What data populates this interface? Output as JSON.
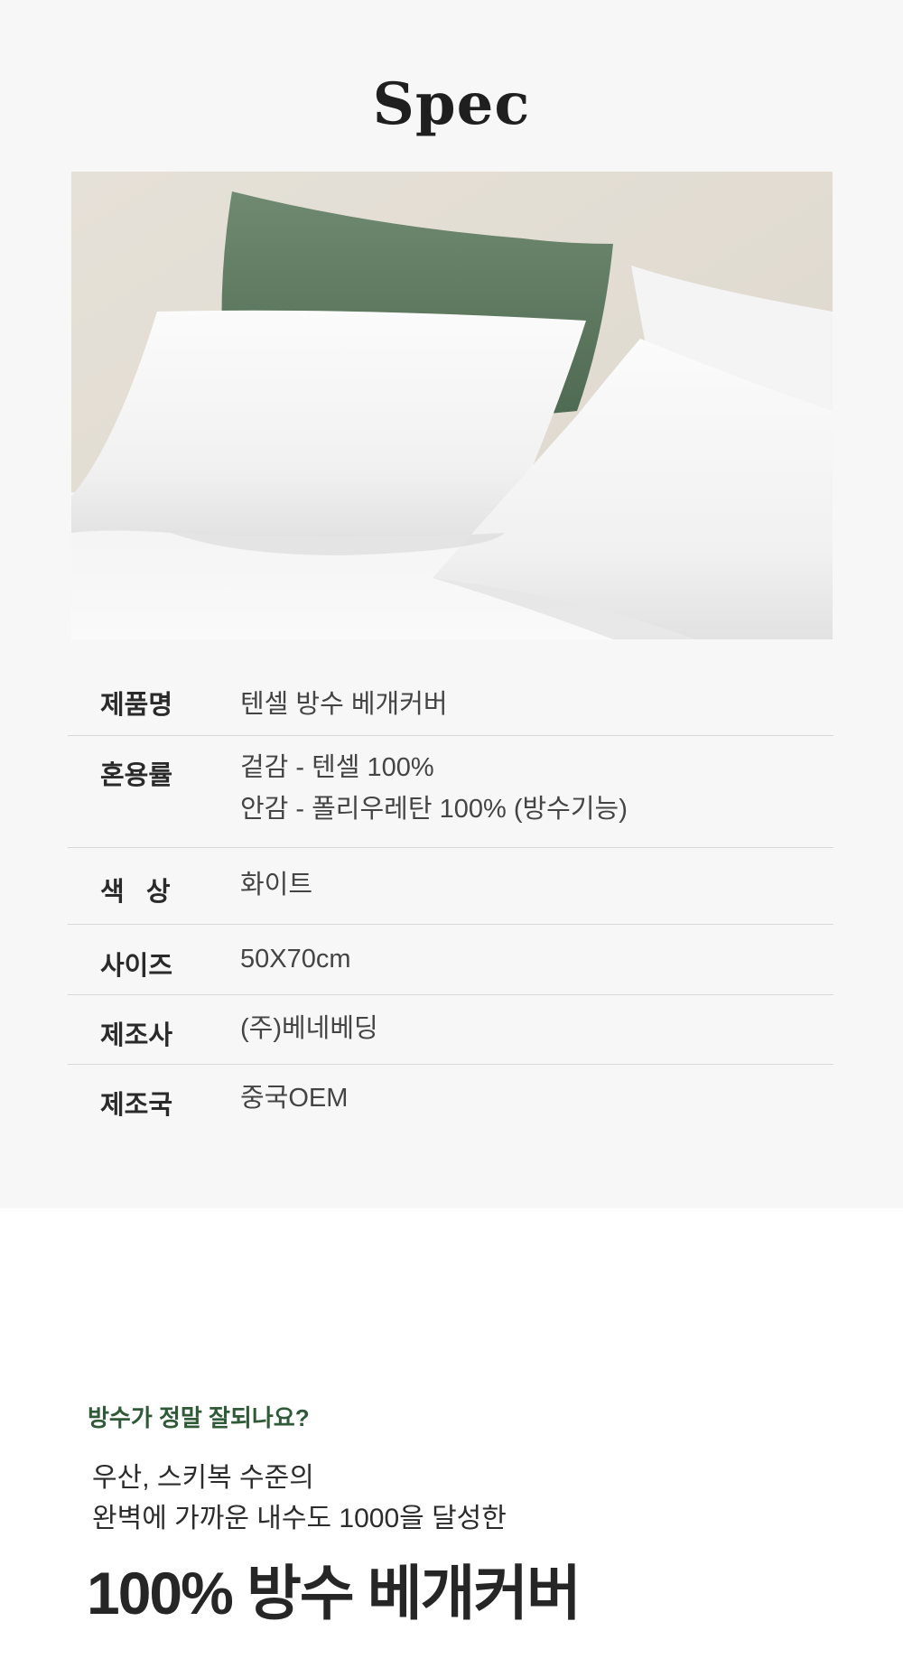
{
  "spec": {
    "title": "Spec",
    "rows": [
      {
        "label": "제품명",
        "values": [
          "텐셀 방수 베개커버"
        ]
      },
      {
        "label": "혼용률",
        "values": [
          "겉감 - 텐셀 100%",
          "안감 - 폴리우레탄 100% (방수기능)"
        ]
      },
      {
        "label": "색   상",
        "values": [
          "화이트"
        ]
      },
      {
        "label": "사이즈",
        "values": [
          "50X70cm"
        ]
      },
      {
        "label": "제조사",
        "values": [
          "(주)베네베딩"
        ]
      },
      {
        "label": "제조국",
        "values": [
          "중국OEM"
        ]
      }
    ]
  },
  "qa": {
    "question": "방수가 정말 잘되나요?",
    "lines": [
      "우산, 스키복 수준의",
      "완벽에 가까운 내수도 1000을 달성한"
    ],
    "headline": "100% 방수 베개커버"
  },
  "colors": {
    "accent_green": "#2f5a38",
    "spec_background": "#f7f7f7",
    "divider": "#d9d9d9"
  }
}
